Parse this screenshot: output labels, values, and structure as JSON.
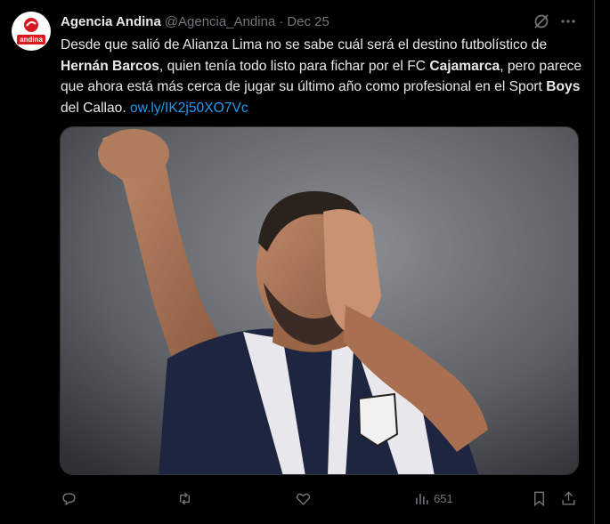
{
  "account": {
    "name": "Agencia Andina",
    "handle": "@Agencia_Andina",
    "separator": "·",
    "date": "Dec 25",
    "avatar_text": "andina"
  },
  "tweet": {
    "t1": "Desde que salió de Alianza Lima no se sabe cuál será el destino futbolístico de ",
    "b1": "Hernán Barcos",
    "t2": ", quien tenía todo listo para fichar por el FC ",
    "b2": "Cajamarca",
    "t3": ", pero parece que ahora está más cerca de jugar su último año como profesional en el Sport ",
    "b3": "Boys",
    "t4": " del Callao. ",
    "link": "ow.ly/IK2j50XO7Vc"
  },
  "actions": {
    "views_count": "651"
  },
  "icons": {
    "grok": "grok-icon",
    "more": "more-icon",
    "reply": "reply-icon",
    "retweet": "retweet-icon",
    "like": "like-icon",
    "views": "views-icon",
    "bookmark": "bookmark-icon",
    "share": "share-icon"
  },
  "colors": {
    "background": "#000000",
    "text": "#e7e9ea",
    "secondary": "#71767b",
    "link": "#1d9bf0",
    "brand_red": "#d71920"
  }
}
